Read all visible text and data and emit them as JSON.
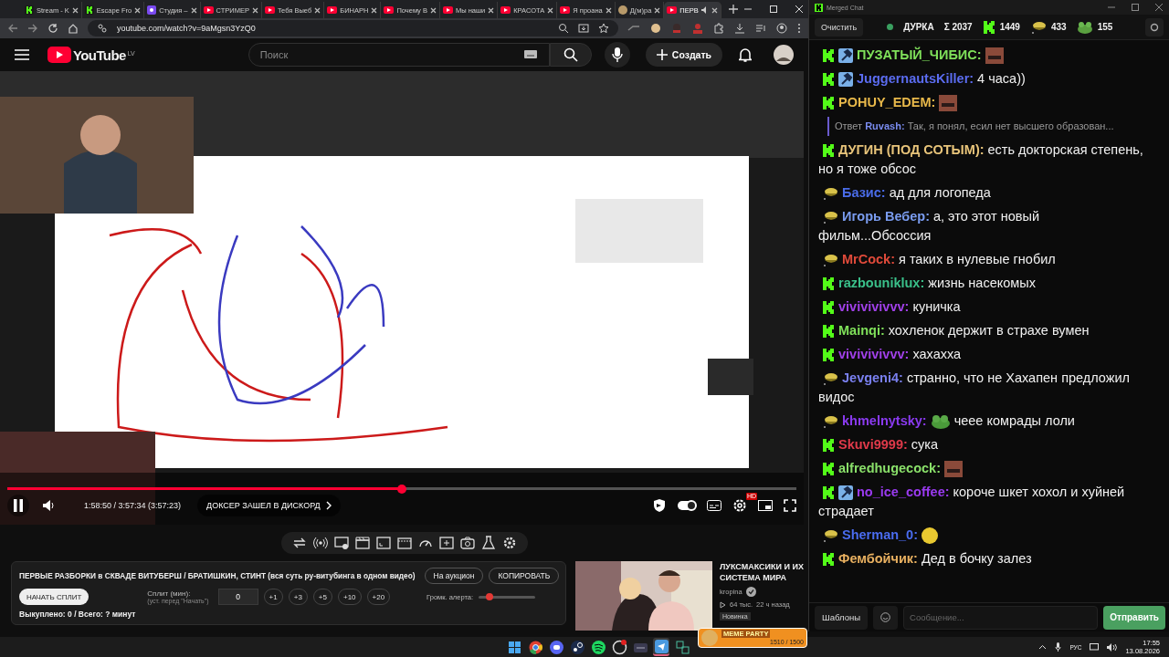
{
  "browser": {
    "tabs": [
      {
        "kind": "kick",
        "title": "Stream - K",
        "selected": false
      },
      {
        "kind": "kick",
        "title": "Escape Fro",
        "selected": false
      },
      {
        "kind": "studio",
        "title": "Студия –",
        "selected": false
      },
      {
        "kind": "youtube",
        "title": "СТРИМЕР",
        "selected": false
      },
      {
        "kind": "youtube",
        "title": "Тебя Выеб",
        "selected": false
      },
      {
        "kind": "youtube",
        "title": "БИНАРН",
        "selected": false
      },
      {
        "kind": "youtube",
        "title": "Почему В",
        "selected": false
      },
      {
        "kind": "youtube",
        "title": "Мы наши",
        "selected": false
      },
      {
        "kind": "youtube",
        "title": "КРАСОТА",
        "selected": false
      },
      {
        "kind": "youtube",
        "title": "Я проана",
        "selected": false
      },
      {
        "kind": "doc",
        "title": "Д(м)ра",
        "selected": false
      },
      {
        "kind": "youtube",
        "title": "ПЕРВ",
        "selected": true
      }
    ],
    "address": "youtube.com/watch?v=9aMgsn3YzQ0"
  },
  "youtube": {
    "logo": "YouTube",
    "region": "LV",
    "search_placeholder": "Поиск",
    "create_label": "Создать"
  },
  "player": {
    "level": 0.5,
    "time": "1:58:50 / 3:57:34 (3:57:23)",
    "chapter": "ДОКСЕР ЗАШЕЛ В ДИСКОРД",
    "autoplay_on": true,
    "settings_badge": "HD"
  },
  "split_panel": {
    "title": "ПЕРВЫЕ РАЗБОРКИ в СКВАДЕ ВИТУБЕРШ / БРАТИШКИН, СТИНТ (вся суть ру-витубинга в одном видео)",
    "auction_button": "На аукцион",
    "copy_button": "КОПИРОВАТЬ",
    "start_button": "НАЧАТЬ СПЛИТ",
    "split_label": "Сплит (мин):",
    "split_hint": "(уст. перед \"Начать\")",
    "split_value": "0",
    "increments": [
      "+1",
      "+3",
      "+5",
      "+10",
      "+20"
    ],
    "volume_label": "Громк. алерта:",
    "volume": {
      "level": 0.2
    },
    "summary": "Выкуплено: 0 / Всего: ? минут"
  },
  "recommendation": {
    "title": "ЛУКСМАКСИКИ И ИХ СИСТЕМА МИРА",
    "channel": "kropina",
    "verified": true,
    "views": "64 тыс.",
    "age": "22 ч назад",
    "badge": "Новинка"
  },
  "meme_widget": {
    "title": "MEME PARTY",
    "count": "1510 / 1500"
  },
  "chat": {
    "window_title": "Merged Chat",
    "clear_button": "Очистить",
    "live": true,
    "channel": "ДУРКА",
    "stats": [
      {
        "kind": "total",
        "value": "Σ 2037"
      },
      {
        "kind": "kick",
        "value": "1449"
      },
      {
        "kind": "hat",
        "value": "433"
      },
      {
        "kind": "frog",
        "value": "155"
      }
    ],
    "messages": [
      {
        "kind": "kick",
        "mod": true,
        "name": "ПУЗАТЫЙ_ЧИБИС:",
        "color": "#7fe05a",
        "content": [
          {
            "kind": "face"
          }
        ]
      },
      {
        "kind": "kick",
        "mod": true,
        "name": "JuggernautsKiller:",
        "color": "#5b6cf0",
        "content": [
          {
            "kind": "text",
            "text": "4 часа))"
          }
        ]
      },
      {
        "kind": "kick",
        "mod": false,
        "name": "POHUY_EDEM:",
        "color": "#e8b84a",
        "content": [
          {
            "kind": "face"
          }
        ]
      },
      {
        "kind": "reply",
        "label": "Ответ",
        "name": "Ruvash:",
        "color": "#7a8cf0",
        "text": "Так, я понял, есил нет высшего образован..."
      },
      {
        "kind": "kick",
        "mod": false,
        "name": "ДУГИН (ПОД СОТЫМ):",
        "color": "#e8c47a",
        "content": [
          {
            "kind": "text",
            "text": "есть докторская степень,"
          },
          {
            "kind": "line",
            "text": "но я тоже обсос"
          }
        ]
      },
      {
        "kind": "hat",
        "mod": false,
        "name": "Базис:",
        "color": "#4a6ce8",
        "content": [
          {
            "kind": "text",
            "text": "ад для логопеда"
          }
        ]
      },
      {
        "kind": "hat",
        "mod": false,
        "name": "Игорь Вебер:",
        "color": "#7a9cf0",
        "content": [
          {
            "kind": "text",
            "text": "а, это этот новый"
          },
          {
            "kind": "line",
            "text": "фильм...Обсоссия"
          }
        ]
      },
      {
        "kind": "hat",
        "mod": false,
        "name": "MrCock:",
        "color": "#e04a3a",
        "content": [
          {
            "kind": "text",
            "text": "я таких в нулевые гнобил"
          }
        ]
      },
      {
        "kind": "kick",
        "mod": false,
        "name": "razbouniklux:",
        "color": "#3ac08a",
        "content": [
          {
            "kind": "text",
            "text": "жизнь насекомых"
          }
        ]
      },
      {
        "kind": "kick",
        "mod": false,
        "name": "vivivivivvv:",
        "color": "#a040e8",
        "content": [
          {
            "kind": "text",
            "text": "куничка"
          }
        ]
      },
      {
        "kind": "kick",
        "mod": false,
        "name": "Mainqi:",
        "color": "#7fe05a",
        "content": [
          {
            "kind": "text",
            "text": "хохленок держит в страхе вумен"
          }
        ]
      },
      {
        "kind": "kick",
        "mod": false,
        "name": "vivivivivvv:",
        "color": "#a040e8",
        "content": [
          {
            "kind": "text",
            "text": "хахахха"
          }
        ]
      },
      {
        "kind": "hat",
        "mod": false,
        "name": "Jevgeni4:",
        "color": "#7a80f0",
        "content": [
          {
            "kind": "text",
            "text": "странно, что не Хахапен предложил"
          },
          {
            "kind": "line",
            "text": "видос"
          }
        ]
      },
      {
        "kind": "hat",
        "mod": false,
        "name": "khmelnytsky:",
        "color": "#8a3af0",
        "content": [
          {
            "kind": "frog"
          },
          {
            "kind": "text",
            "text": "чеее комрады лоли"
          }
        ]
      },
      {
        "kind": "kick",
        "mod": false,
        "name": "Skuvi9999:",
        "color": "#e03a4a",
        "content": [
          {
            "kind": "text",
            "text": "сука"
          }
        ]
      },
      {
        "kind": "kick",
        "mod": false,
        "name": "alfredhugecock:",
        "color": "#8ae06a",
        "content": [
          {
            "kind": "face"
          }
        ]
      },
      {
        "kind": "kick",
        "mod": true,
        "name": "no_ice_coffee:",
        "color": "#9a3af0",
        "content": [
          {
            "kind": "text",
            "text": "короче шкет хохол и хуйней"
          },
          {
            "kind": "line",
            "text": "страдает"
          }
        ]
      },
      {
        "kind": "hat",
        "mod": false,
        "name": "Sherman_0:",
        "color": "#4a6cf0",
        "content": [
          {
            "kind": "smiley"
          }
        ]
      },
      {
        "kind": "kick",
        "mod": false,
        "name": "Фембойчик:",
        "color": "#e8b060",
        "content": [
          {
            "kind": "text",
            "text": "Дед в бочку залез"
          }
        ]
      }
    ],
    "templates_button": "Шаблоны",
    "placeholder": "Сообщение...",
    "send_button": "Отправить"
  },
  "taskbar": {
    "apps": [
      {
        "kind": "windows",
        "selected": false
      },
      {
        "kind": "chrome",
        "selected": false
      },
      {
        "kind": "discord",
        "selected": false
      },
      {
        "kind": "steam",
        "selected": false
      },
      {
        "kind": "spotify",
        "selected": false
      },
      {
        "kind": "recorder",
        "selected": false
      },
      {
        "kind": "window",
        "selected": false
      },
      {
        "kind": "telegram",
        "selected": true
      },
      {
        "kind": "screens",
        "selected": false
      }
    ],
    "language": "РУС",
    "time": "17:55",
    "date": "13.08.2026"
  }
}
